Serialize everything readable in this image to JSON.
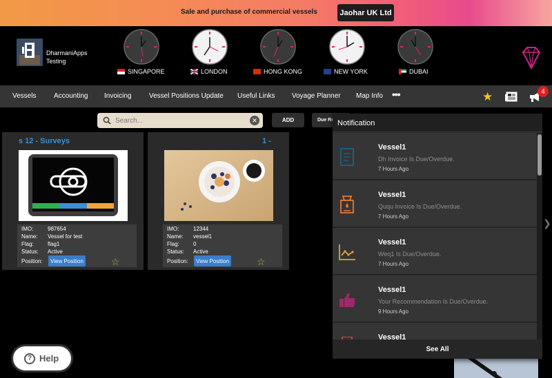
{
  "banner": {
    "text": "Sale and purchase of commercial vessels",
    "button": "Jaohar UK Ltd"
  },
  "brand": {
    "line1": "DharmaniApps",
    "line2": "Testing"
  },
  "clocks": [
    {
      "city": "SINGAPORE"
    },
    {
      "city": "LONDON"
    },
    {
      "city": "HONG KONG"
    },
    {
      "city": "NEW YORK"
    },
    {
      "city": "DUBAI"
    }
  ],
  "nav": {
    "items": [
      "Vessels",
      "Accounting",
      "Invoicing",
      "Vessel Positions Update",
      "Useful Links",
      "Voyage Planner",
      "Map Info"
    ],
    "more": "•••",
    "badge_count": "4"
  },
  "toolbar": {
    "search_placeholder": "Search...",
    "add_label": "ADD",
    "due_label": "Due Re"
  },
  "sections": {
    "left_title": "s 12 - Surveys",
    "right_title": "1 -"
  },
  "vessels": [
    {
      "imo_k": "IMO:",
      "imo": "987654",
      "name_k": "Name:",
      "name": "Vessel for test",
      "flag_k": "Flag:",
      "flag": "flag1",
      "status_k": "Status:",
      "status": "Active",
      "position_k": "Position:",
      "view_label": "View Position"
    },
    {
      "imo_k": "IMO:",
      "imo": "12344",
      "name_k": "Name:",
      "name": "vessel1",
      "flag_k": "Flag:",
      "flag": "0",
      "status_k": "Status:",
      "status": "Active",
      "position_k": "Position:",
      "view_label": "View Position"
    }
  ],
  "notifications": {
    "title": "Notification",
    "see_all": "See All",
    "items": [
      {
        "vessel": "Vessel1",
        "message": "Dh Invoice Is Due/Overdue.",
        "time": "7 Hours Ago",
        "icon": "document-icon",
        "color": "#1d5e7a"
      },
      {
        "vessel": "Vessel1",
        "message": "Ququ Invoice Is Due/Overdue.",
        "time": "7 Hours Ago",
        "icon": "cooler-icon",
        "color": "#e8792b"
      },
      {
        "vessel": "Vessel1",
        "message": "Weq1 Is Due/Overdue.",
        "time": "7 Hours Ago",
        "icon": "chart-icon",
        "color": "#e0a33b"
      },
      {
        "vessel": "Vessel1",
        "message": "Your Recommendation Is Due/Overdue.",
        "time": "9 Hours Ago",
        "icon": "thumbs-up-icon",
        "color": "#9c2a6a"
      },
      {
        "vessel": "Vessel1",
        "message": "",
        "time": "",
        "icon": "generic-icon",
        "color": "#d24242"
      }
    ]
  },
  "help": {
    "label": "Help"
  }
}
